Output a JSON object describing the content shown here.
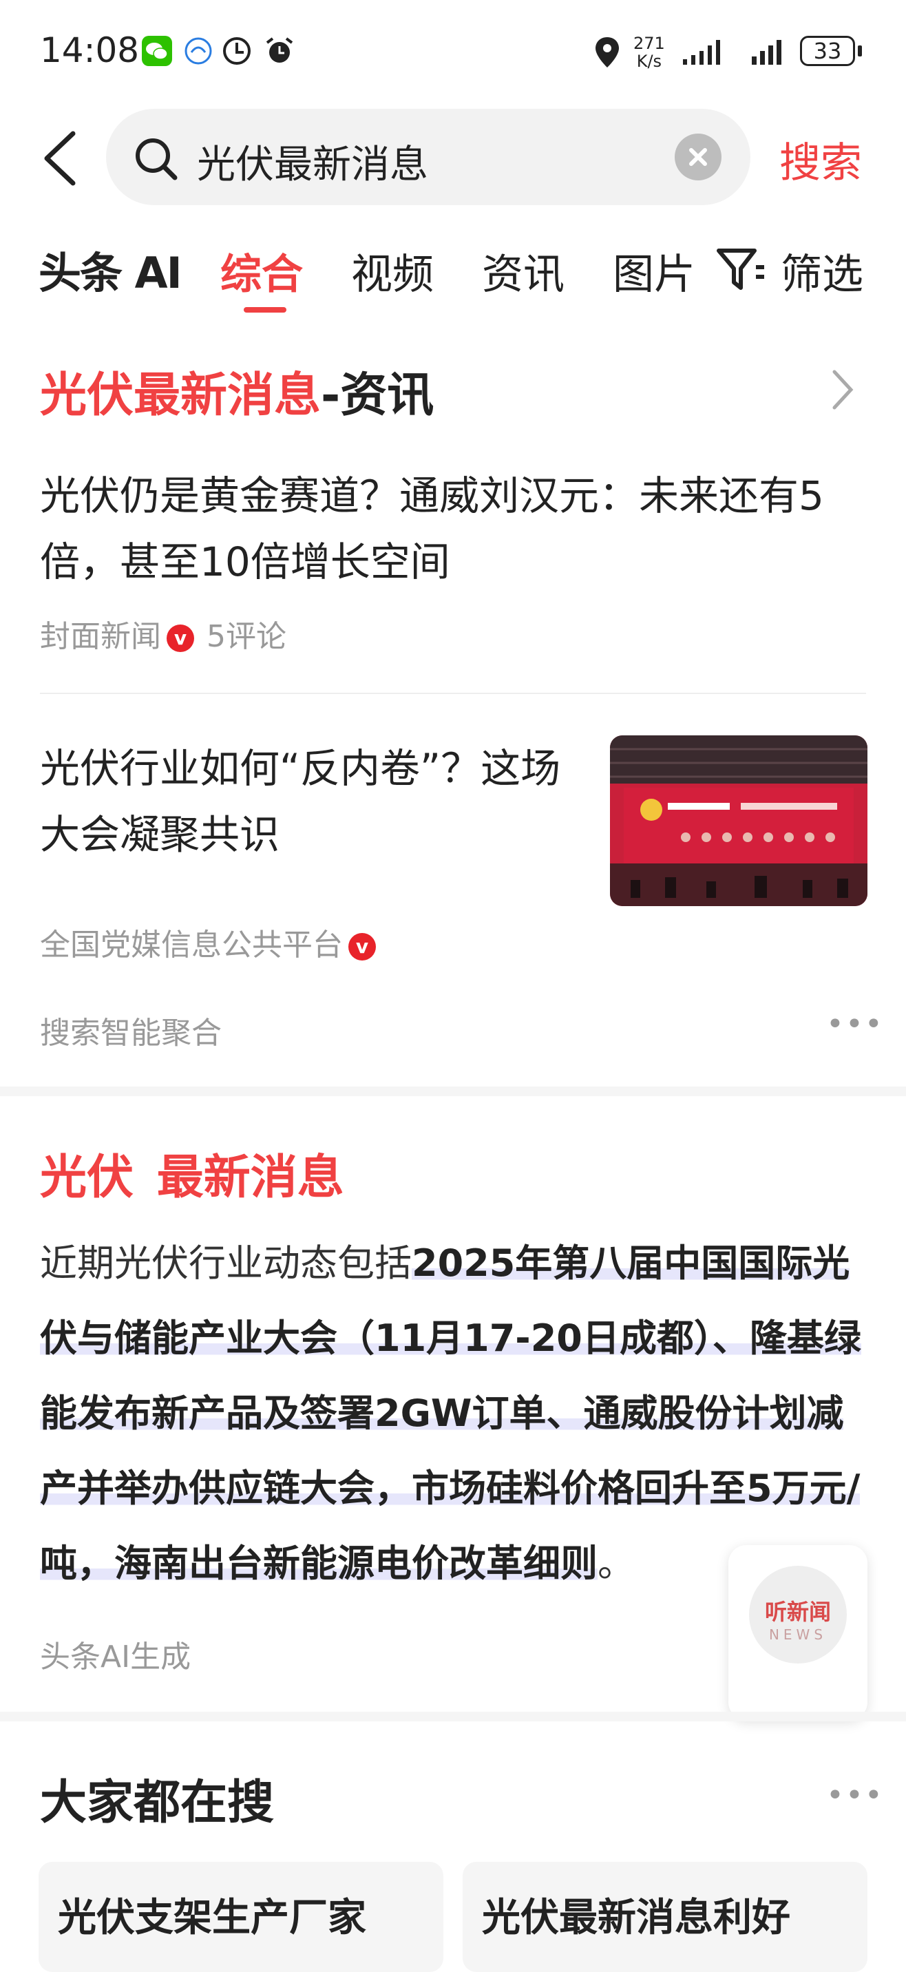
{
  "status_bar": {
    "time": "14:08",
    "net_speed_value": "271",
    "net_speed_unit": "K/s",
    "battery": "33"
  },
  "search": {
    "query": "光伏最新消息",
    "button_label": "搜索"
  },
  "tabs": {
    "logo": "头条 AI",
    "items": [
      "综合",
      "视频",
      "资讯",
      "图片"
    ],
    "active": "综合",
    "filter_label": "筛选"
  },
  "news_section": {
    "title_keyword": "光伏最新消息",
    "title_suffix": "-资讯",
    "articles": [
      {
        "title": "光伏仍是黄金赛道？通威刘汉元：未来还有5倍，甚至10倍增长空间",
        "source": "封面新闻",
        "comments": "5评论"
      },
      {
        "title": "光伏行业如何“反内卷”？这场大会凝聚共识",
        "source": "全国党媒信息公共平台"
      }
    ],
    "footer_label": "搜索智能聚合"
  },
  "ai_section": {
    "title_keyword1": "光伏",
    "title_keyword2": "最新消息",
    "body_intro": "近期光伏行业动态包括",
    "body_highlight": "2025年第八届中国国际光伏与储能产业大会（11月17-20日成都）、隆基绿能发布新产品及签署2GW订单、通威股份计划减产并举办供应链大会，市场硅料价格回升至5万元/吨，海南出台新能源电价改革细则",
    "body_end": "。",
    "footer_label": "头条AI生成"
  },
  "floating_button": {
    "label_cn": "听新闻",
    "label_en": "NEWS"
  },
  "popular": {
    "title": "大家都在搜",
    "items": [
      "光伏支架生产厂家",
      "光伏最新消息利好"
    ]
  },
  "colors": {
    "accent": "#f04142",
    "meta_text": "#999999",
    "highlight_bg": "#e6e6fb"
  }
}
